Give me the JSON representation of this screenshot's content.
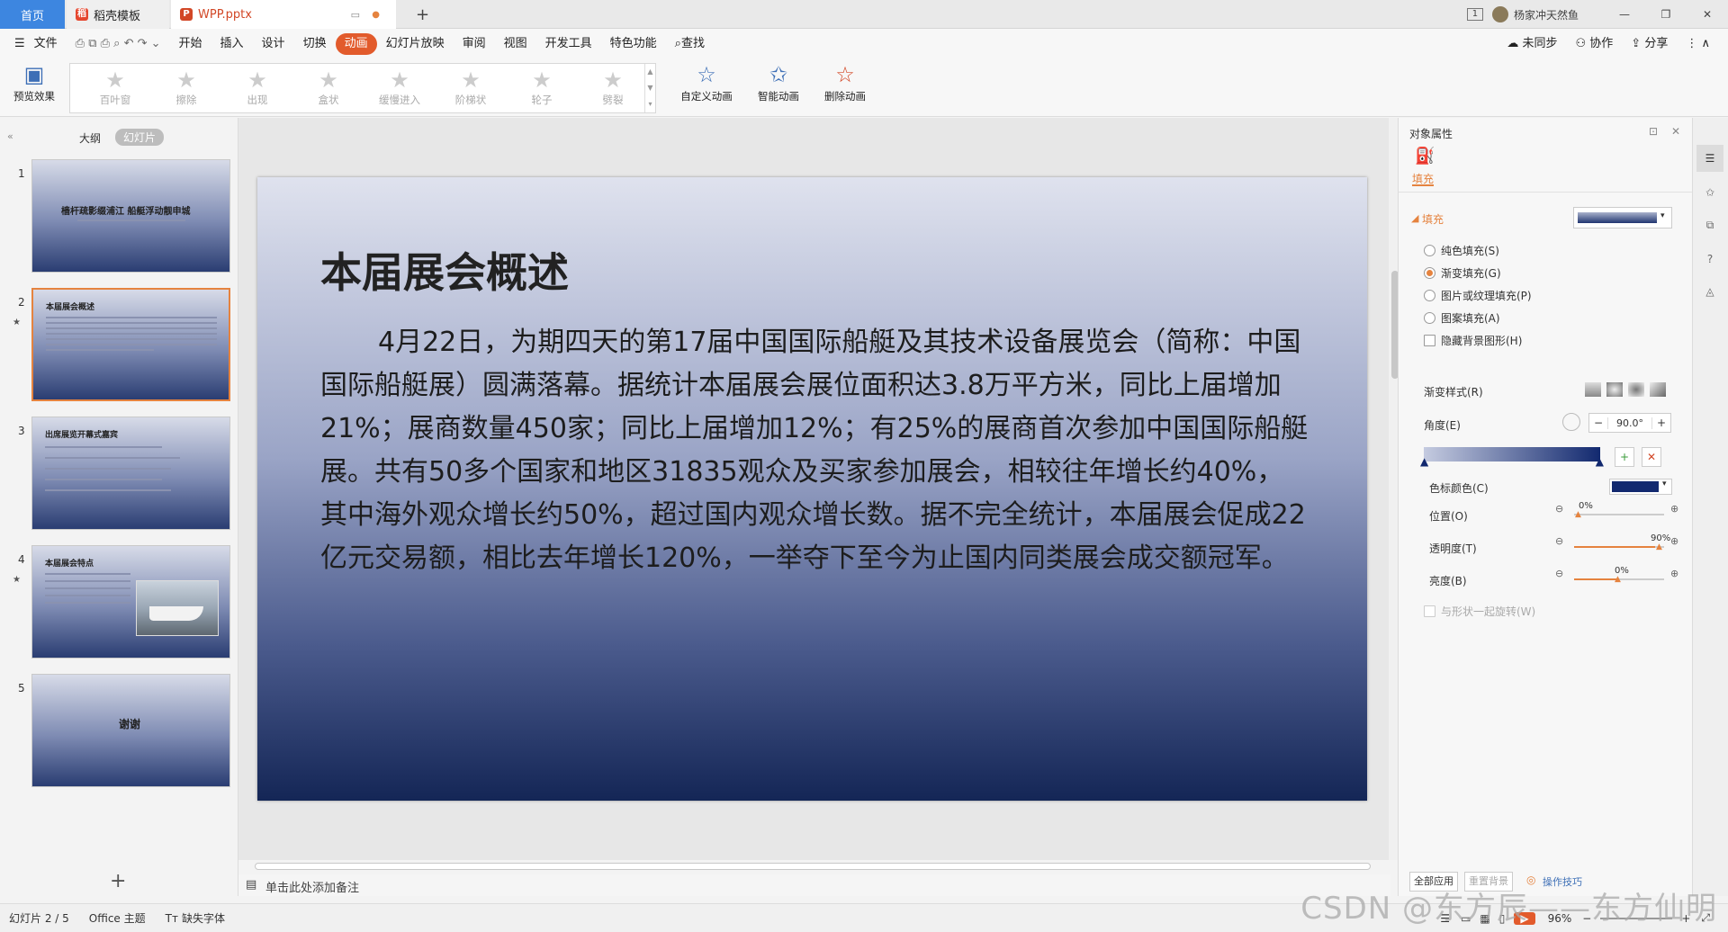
{
  "tabs": {
    "home": "首页",
    "template": "稻壳模板",
    "doc": "WPP.pptx",
    "new_tab": "+"
  },
  "user": {
    "badge": "1",
    "name": "杨家冲天然鱼"
  },
  "menu": {
    "file": "文件",
    "items": [
      "开始",
      "插入",
      "设计",
      "切换",
      "动画",
      "幻灯片放映",
      "审阅",
      "视图",
      "开发工具",
      "特色功能"
    ],
    "active": "动画",
    "search": "查找",
    "sync": "未同步",
    "collab": "协作",
    "share": "分享"
  },
  "ribbon": {
    "preview": "预览效果",
    "gallery": [
      "百叶窗",
      "擦除",
      "出现",
      "盒状",
      "缓慢进入",
      "阶梯状",
      "轮子",
      "劈裂"
    ],
    "custom": "自定义动画",
    "smart": "智能动画",
    "delete": "删除动画"
  },
  "leftpanel": {
    "outline": "大纲",
    "slides": "幻灯片",
    "thumbs": [
      {
        "num": "1",
        "title": "樯杆疏影缀浦江  船艇浮动靓申城"
      },
      {
        "num": "2",
        "title": "本届展会概述"
      },
      {
        "num": "3",
        "title": "出席展览开幕式嘉宾"
      },
      {
        "num": "4",
        "title": "本届展会特点"
      },
      {
        "num": "5",
        "title": "谢谢"
      }
    ]
  },
  "slide": {
    "title": "本届展会概述",
    "body": "4月22日，为期四天的第17届中国国际船艇及其技术设备展览会（简称：中国国际船艇展）圆满落幕。据统计本届展会展位面积达3.8万平方米，同比上届增加21%；展商数量450家；同比上届增加12%；有25%的展商首次参加中国国际船艇展。共有50多个国家和地区31835观众及买家参加展会，相较往年增长约40%，其中海外观众增长约50%，超过国内观众增长数。据不完全统计，本届展会促成22亿元交易额，相比去年增长120%，一举夺下至今为止国内同类展会成交额冠军。"
  },
  "notes": "单击此处添加备注",
  "props": {
    "title": "对象属性",
    "fill_tab": "填充",
    "fill_section": "填充",
    "options": [
      "纯色填充(S)",
      "渐变填充(G)",
      "图片或纹理填充(P)",
      "图案填充(A)"
    ],
    "selected": "渐变填充(G)",
    "hide_bg": "隐藏背景图形(H)",
    "gradient_style": "渐变样式(R)",
    "angle_label": "角度(E)",
    "angle_value": "90.0°",
    "stop_color": "色标颜色(C)",
    "position_label": "位置(O)",
    "position_value": "0%",
    "transparency_label": "透明度(T)",
    "transparency_value": "90%",
    "brightness_label": "亮度(B)",
    "brightness_value": "0%",
    "rotate_with_shape": "与形状一起旋转(W)",
    "apply_all": "全部应用",
    "reset_bg": "重置背景",
    "tips": "操作技巧",
    "stop_color_hex": "#12296f"
  },
  "status": {
    "slide": "幻灯片 2 / 5",
    "theme": "Office 主题",
    "font": "缺失字体",
    "zoom": "96%"
  },
  "watermark": "CSDN @东方辰——东方仙明"
}
